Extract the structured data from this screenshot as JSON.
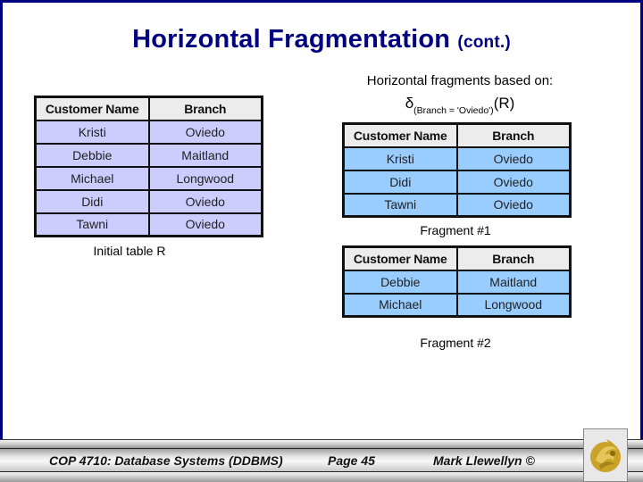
{
  "slide": {
    "title": "Horizontal Fragmentation",
    "title_suffix": "(cont.)",
    "right_caption": "Horizontal fragments based on:",
    "formula": {
      "operator": "δ",
      "condition": "(Branch = 'Oviedo')",
      "relation": "(R)"
    }
  },
  "tables": {
    "initial": {
      "caption": "Initial table R",
      "columns": [
        "Customer Name",
        "Branch"
      ],
      "rows": [
        [
          "Kristi",
          "Oviedo"
        ],
        [
          "Debbie",
          "Maitland"
        ],
        [
          "Michael",
          "Longwood"
        ],
        [
          "Didi",
          "Oviedo"
        ],
        [
          "Tawni",
          "Oviedo"
        ]
      ]
    },
    "fragment1": {
      "caption": "Fragment #1",
      "columns": [
        "Customer Name",
        "Branch"
      ],
      "rows": [
        [
          "Kristi",
          "Oviedo"
        ],
        [
          "Didi",
          "Oviedo"
        ],
        [
          "Tawni",
          "Oviedo"
        ]
      ]
    },
    "fragment2": {
      "caption": "Fragment #2",
      "columns": [
        "Customer Name",
        "Branch"
      ],
      "rows": [
        [
          "Debbie",
          "Maitland"
        ],
        [
          "Michael",
          "Longwood"
        ]
      ]
    }
  },
  "footer": {
    "course": "COP 4710: Database Systems  (DDBMS)",
    "page": "Page 45",
    "author": "Mark Llewellyn ©",
    "logo_icon": "ucf-pegasus-logo"
  },
  "colors": {
    "title": "#000080",
    "frame": "#000080",
    "initial_row_bg": "#ccccff",
    "fragment_row_bg": "#99ccff",
    "header_bg": "#ececec",
    "logo_gold": "#c9a227"
  }
}
